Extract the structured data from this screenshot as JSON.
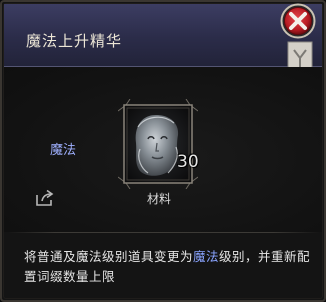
{
  "tooltip": {
    "title": "魔法上升精华",
    "item_type": "魔法",
    "item": {
      "name_label": "材料",
      "count": "30",
      "icon": "female-face-essence-icon"
    },
    "description": {
      "part1": "将普通及魔法级别道具变更为",
      "highlight": "魔法",
      "part2": "级别，并重新配置词缀数量上限"
    },
    "colors": {
      "header": "#35365a",
      "highlight": "#8aa4ff",
      "close": "#b81c23"
    }
  }
}
